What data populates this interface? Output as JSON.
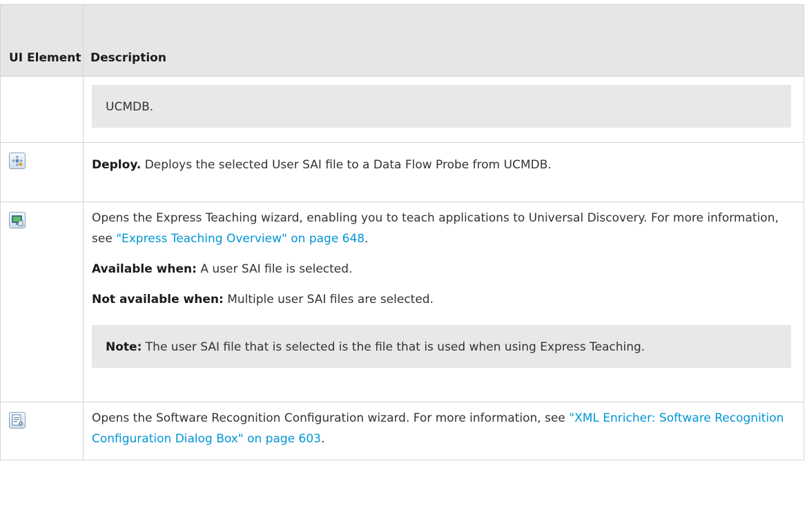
{
  "table": {
    "headers": {
      "ui_element": "UI Element",
      "description": "Description"
    },
    "rows": [
      {
        "icon": null,
        "note_text": "UCMDB."
      },
      {
        "icon": "deploy-icon",
        "bold": "Deploy.",
        "text": " Deploys the selected User SAI file to a Data Flow Probe from UCMDB."
      },
      {
        "icon": "express-teaching-icon",
        "text1": "Opens the Express Teaching wizard, enabling you to teach applications to Universal Discovery. For more information, see ",
        "link": "\"Express Teaching Overview\" on page 648",
        "text1_end": ".",
        "available_label": "Available when:",
        "available_text": " A user SAI file is selected.",
        "not_available_label": "Not available when:",
        "not_available_text": "  Multiple user SAI files are selected.",
        "note_label": "Note:",
        "note_text": " The user SAI file that is selected is the file that is used when using Express Teaching."
      },
      {
        "icon": "software-recognition-icon",
        "text1": "Opens the Software Recognition Configuration wizard. For more information, see ",
        "link": "\"XML Enricher: Software Recognition Configuration Dialog Box\" on page 603",
        "text1_end": "."
      }
    ]
  },
  "colors": {
    "header_bg": "#e6e6e6",
    "note_bg": "#e8e8e8",
    "link": "#0096d6",
    "border": "#d4d4d4"
  }
}
